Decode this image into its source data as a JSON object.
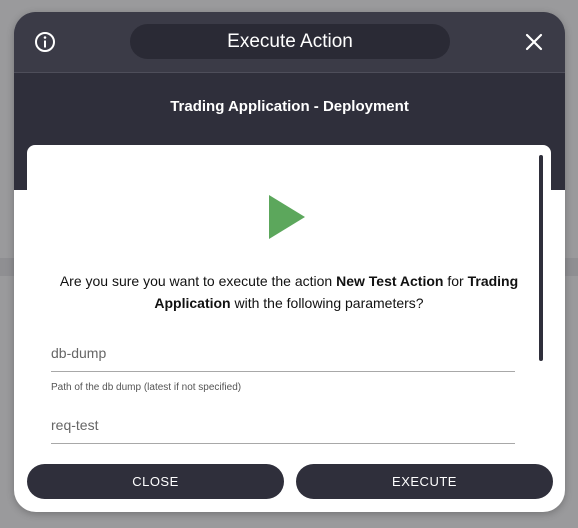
{
  "dialog": {
    "title": "Execute Action",
    "subtitle": "Trading Application - Deployment"
  },
  "confirmation": {
    "prefix": "Are you sure you want to execute the action",
    "action_name": "New Test Action",
    "middle": "for",
    "app_name": "Trading Application",
    "suffix": "with the following parameters?"
  },
  "parameters": [
    {
      "placeholder": "db-dump",
      "hint": "Path of the db dump (latest if not specified)"
    },
    {
      "placeholder": "req-test",
      "hint": ""
    }
  ],
  "buttons": {
    "close": "CLOSE",
    "execute": "EXECUTE"
  },
  "colors": {
    "header_dark": "#2f2f3b",
    "play_green": "#5ca75c"
  }
}
